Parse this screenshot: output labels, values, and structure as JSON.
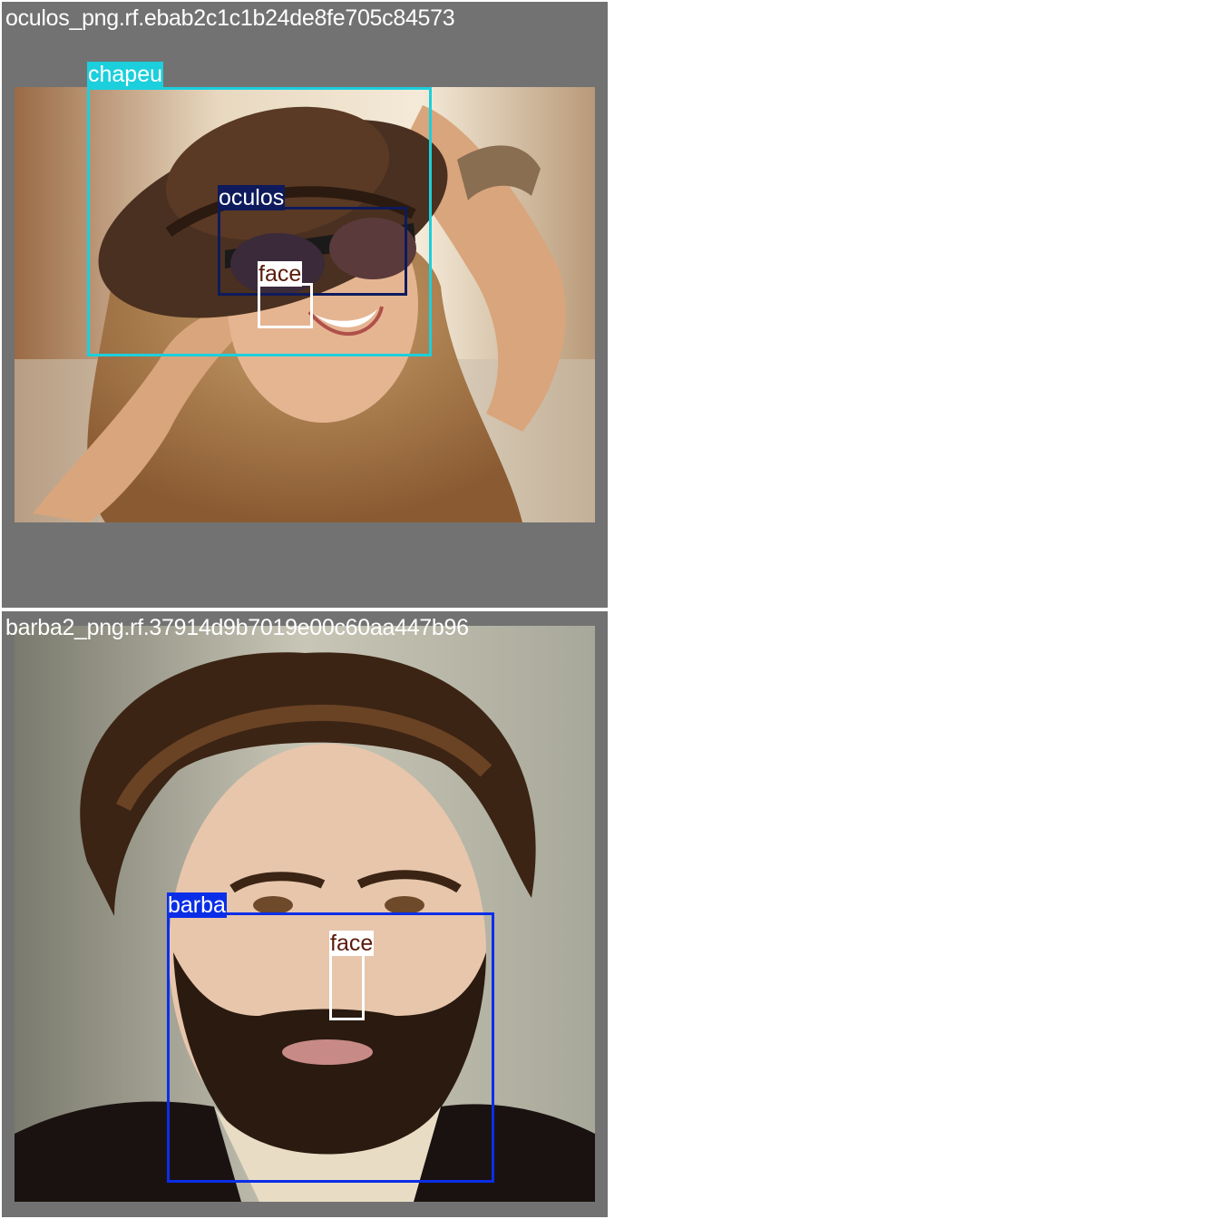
{
  "tiles": [
    {
      "filename": "oculos_png.rf.ebab2c1c1b24de8fe705c84573",
      "boxes": [
        {
          "label": "chapeu",
          "color": "#1ccfdc",
          "text_color": "#ffffff"
        },
        {
          "label": "oculos",
          "color": "#0e1a5c",
          "text_color": "#ffffff"
        },
        {
          "label": "face",
          "color": "#ffffff",
          "text_color": "#5a1a0a"
        }
      ]
    },
    {
      "filename": "barba2_png.rf.37914d9b7019e00c60aa447b96",
      "boxes": [
        {
          "label": "barba",
          "color": "#0a2ee8",
          "text_color": "#ffffff"
        },
        {
          "label": "face",
          "color": "#ffffff",
          "text_color": "#5a1a0a"
        }
      ]
    }
  ]
}
